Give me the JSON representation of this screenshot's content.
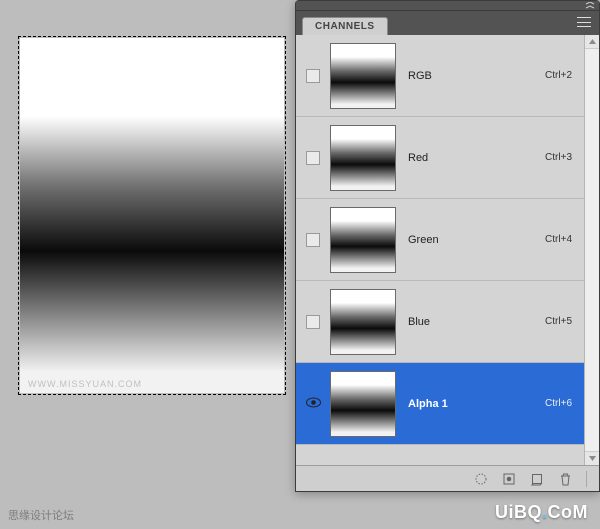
{
  "panel": {
    "tab": "CHANNELS",
    "channels": [
      {
        "name": "RGB",
        "shortcut": "Ctrl+2",
        "visible": false,
        "selected": false
      },
      {
        "name": "Red",
        "shortcut": "Ctrl+3",
        "visible": false,
        "selected": false
      },
      {
        "name": "Green",
        "shortcut": "Ctrl+4",
        "visible": false,
        "selected": false
      },
      {
        "name": "Blue",
        "shortcut": "Ctrl+5",
        "visible": false,
        "selected": false
      },
      {
        "name": "Alpha 1",
        "shortcut": "Ctrl+6",
        "visible": true,
        "selected": true
      }
    ]
  },
  "watermarks": {
    "left": "思缘设计论坛",
    "inside": "WWW.MISSYUAN.COM",
    "right_brand": "UiBQ",
    "right_tld": "CoM"
  }
}
